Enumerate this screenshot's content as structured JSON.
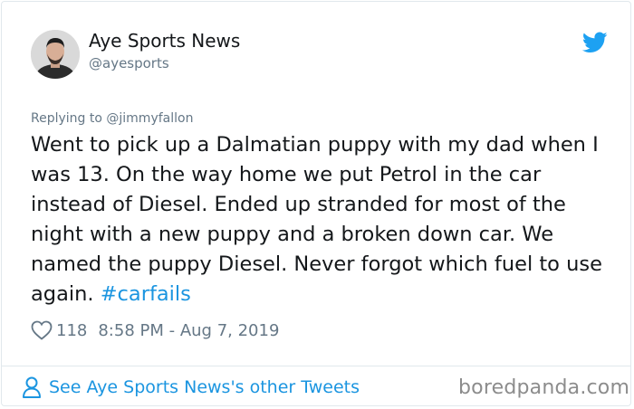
{
  "author": {
    "name": "Aye Sports News",
    "handle": "@ayesports",
    "avatar_icon": "user-avatar"
  },
  "header": {
    "brand_icon": "twitter-bird-icon",
    "brand_color": "#1da1f2"
  },
  "reply_to": {
    "prefix": "Replying to",
    "mention": "@jimmyfallon"
  },
  "tweet": {
    "text": "Went to pick up a Dalmatian puppy with my dad when I was 13. On the way home we put Petrol in the car instead of Diesel. Ended up stranded for most of the night with a new puppy and a broken down car. We named the puppy Diesel. Never forgot which fuel to use again.",
    "hashtag": "#carfails",
    "hashtag_color": "#1b95e0"
  },
  "meta": {
    "like_icon": "heart-icon",
    "likes": "118",
    "timestamp": "8:58 PM - Aug 7, 2019"
  },
  "footer": {
    "person_icon": "person-icon",
    "link_text": "See Aye Sports News's other Tweets"
  },
  "watermark": "boredpanda.com"
}
